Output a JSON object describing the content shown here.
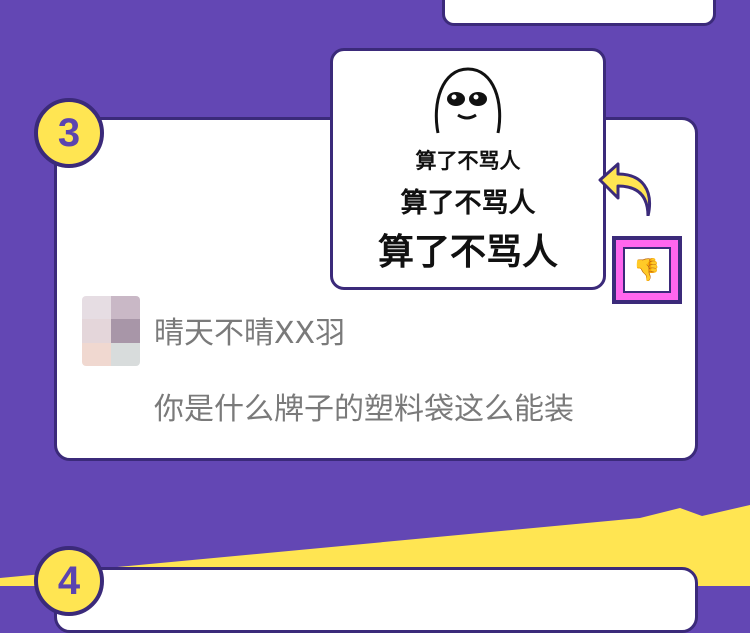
{
  "colors": {
    "background": "#6347b4",
    "accent_yellow": "#ffe552",
    "border": "#3b2a7a",
    "dislike_highlight": "#ff66ee",
    "text_gray": "#7a7a7a"
  },
  "section3": {
    "number": "3",
    "meme": {
      "lines": [
        "算了不骂人",
        "算了不骂人",
        "算了不骂人"
      ]
    },
    "comment": {
      "username": "晴天不晴XX羽",
      "text": "你是什么牌子的塑料袋这么能装"
    },
    "icons": {
      "reply": "reply-arrow-icon",
      "dislike": "thumbs-down-icon"
    }
  },
  "section4": {
    "number": "4"
  }
}
